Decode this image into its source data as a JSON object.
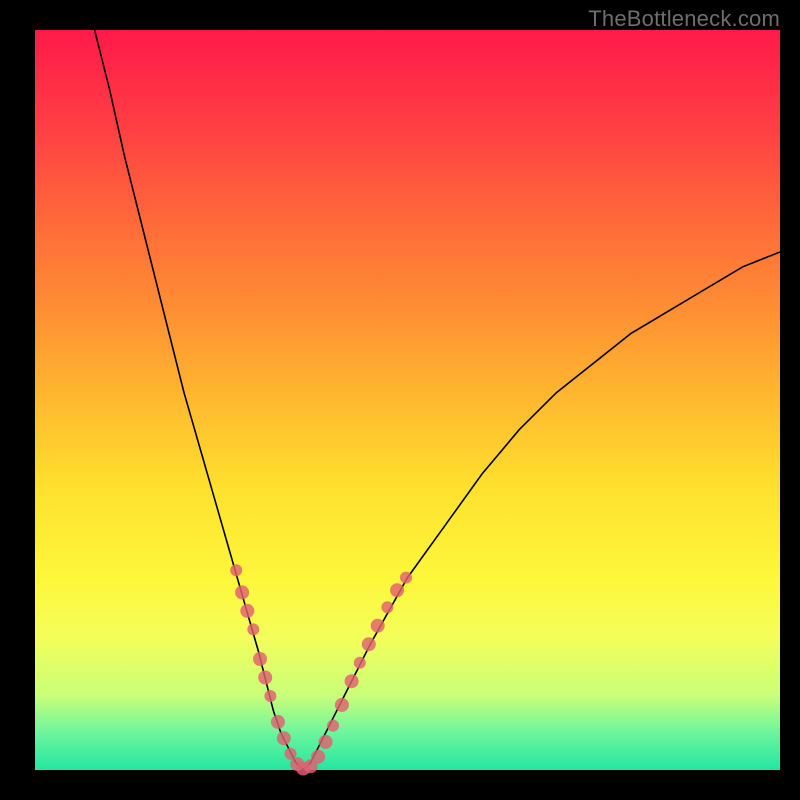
{
  "watermark": "TheBottleneck.com",
  "colors": {
    "frame": "#000000",
    "curve": "#000000",
    "marker": "#e06070",
    "gradient_top": "#ff1a4a",
    "gradient_bottom": "#23e6a0"
  },
  "chart_data": {
    "type": "line",
    "title": "",
    "xlabel": "",
    "ylabel": "",
    "xlim": [
      0,
      100
    ],
    "ylim": [
      0,
      100
    ],
    "series": [
      {
        "name": "bottleneck-curve",
        "x": [
          8,
          10,
          12,
          14,
          16,
          18,
          20,
          22,
          24,
          26,
          28,
          30,
          31,
          32,
          33,
          34,
          35,
          36,
          37,
          38,
          40,
          42,
          45,
          50,
          55,
          60,
          65,
          70,
          75,
          80,
          85,
          90,
          95,
          100
        ],
        "y": [
          100,
          92,
          83,
          75,
          67,
          59,
          51,
          44,
          37,
          30,
          23,
          16,
          12,
          8,
          5,
          3,
          1,
          0,
          1,
          3,
          7,
          11,
          17,
          26,
          33,
          40,
          46,
          51,
          55,
          59,
          62,
          65,
          68,
          70
        ]
      }
    ],
    "markers": {
      "name": "highlighted-points",
      "points": [
        {
          "x": 27.0,
          "y": 27.0,
          "r": 6
        },
        {
          "x": 27.8,
          "y": 24.0,
          "r": 7
        },
        {
          "x": 28.5,
          "y": 21.5,
          "r": 7
        },
        {
          "x": 29.3,
          "y": 19.0,
          "r": 6
        },
        {
          "x": 30.2,
          "y": 15.0,
          "r": 7
        },
        {
          "x": 30.9,
          "y": 12.5,
          "r": 7
        },
        {
          "x": 31.6,
          "y": 10.0,
          "r": 6
        },
        {
          "x": 32.6,
          "y": 6.5,
          "r": 7
        },
        {
          "x": 33.4,
          "y": 4.3,
          "r": 7
        },
        {
          "x": 34.3,
          "y": 2.2,
          "r": 6
        },
        {
          "x": 35.2,
          "y": 0.8,
          "r": 7
        },
        {
          "x": 36.0,
          "y": 0.2,
          "r": 7
        },
        {
          "x": 37.0,
          "y": 0.5,
          "r": 7
        },
        {
          "x": 38.0,
          "y": 1.8,
          "r": 7
        },
        {
          "x": 39.0,
          "y": 3.8,
          "r": 7
        },
        {
          "x": 40.0,
          "y": 6.0,
          "r": 6
        },
        {
          "x": 41.2,
          "y": 8.8,
          "r": 7
        },
        {
          "x": 42.5,
          "y": 12.0,
          "r": 7
        },
        {
          "x": 43.6,
          "y": 14.5,
          "r": 6
        },
        {
          "x": 44.8,
          "y": 17.0,
          "r": 7
        },
        {
          "x": 46.0,
          "y": 19.5,
          "r": 7
        },
        {
          "x": 47.3,
          "y": 22.0,
          "r": 6
        },
        {
          "x": 48.6,
          "y": 24.3,
          "r": 7
        },
        {
          "x": 49.8,
          "y": 26.0,
          "r": 6
        }
      ]
    }
  }
}
